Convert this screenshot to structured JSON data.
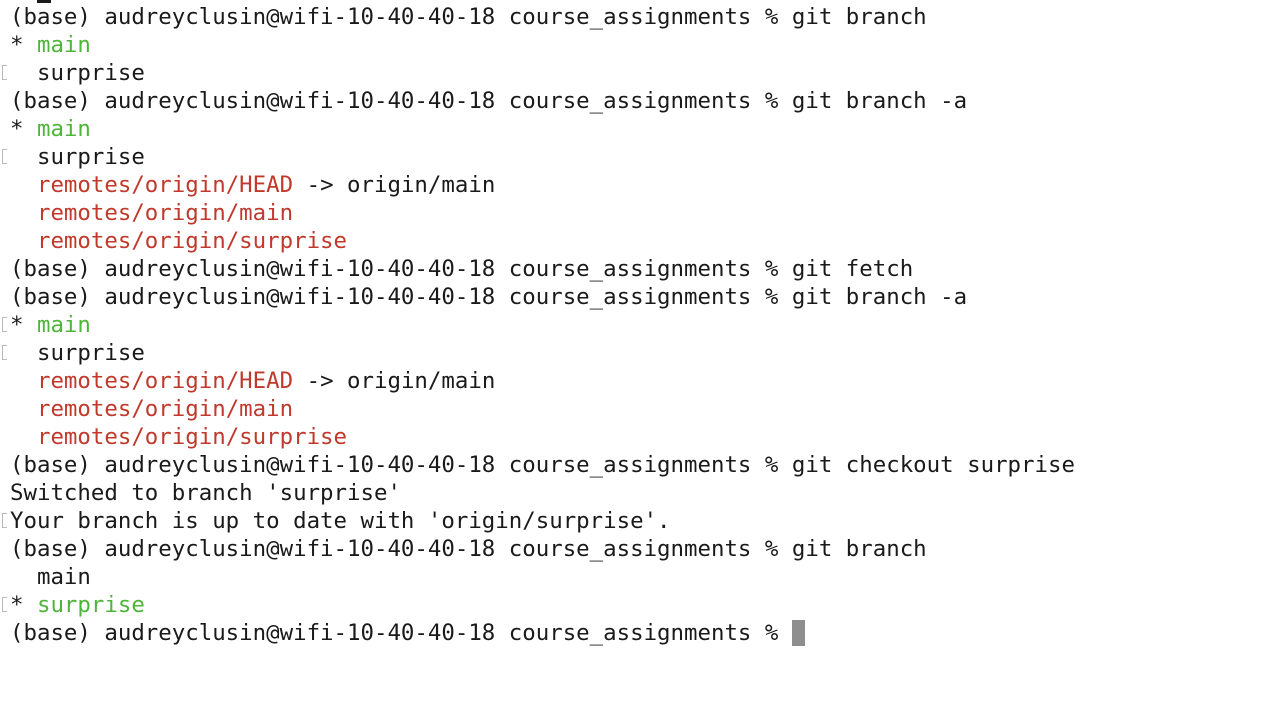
{
  "terminal": {
    "prompt": "(base) audreyclusin@wifi-10-40-40-18 course_assignments % ",
    "cmd_branch": "git branch",
    "cmd_branch_a": "git branch -a",
    "cmd_fetch": "git fetch",
    "cmd_checkout": "git checkout surprise",
    "star": "* ",
    "indent": "  ",
    "main": "main",
    "surprise": "surprise",
    "remote_head": "remotes/origin/HEAD",
    "head_arrow": " -> origin/main",
    "remote_main": "remotes/origin/main",
    "remote_surprise": "remotes/origin/surprise",
    "switched_msg": "Switched to branch 'surprise'",
    "uptodate_msg": "Your branch is up to date with 'origin/surprise'."
  },
  "colors": {
    "current_branch": "#4fb53a",
    "remote_branch": "#c0392b",
    "cursor": "#8e8e8e"
  }
}
